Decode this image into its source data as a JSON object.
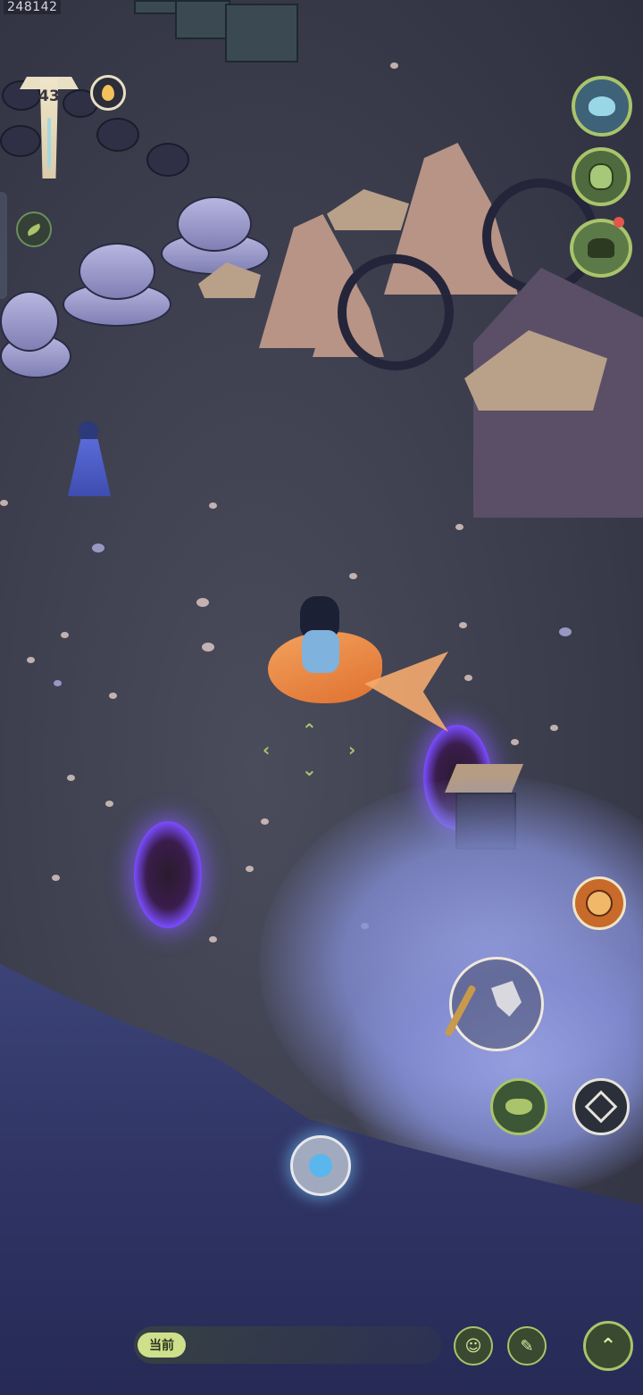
{
  "hud": {
    "player_id": "248142",
    "level": "43",
    "flame_icon": "flame-icon",
    "side_buttons": [
      "leaf-icon"
    ]
  },
  "right_buttons": [
    {
      "name": "wave-button",
      "icon": "wave-icon"
    },
    {
      "name": "jar-button",
      "icon": "jar-icon"
    },
    {
      "name": "monster-button",
      "icon": "monster-icon",
      "notification": true
    }
  ],
  "action_buttons": {
    "face": "face-icon",
    "primary": "axe-icon",
    "cloud": "cloud-icon",
    "diamond": "diamond-icon",
    "orb": "water-orb-icon"
  },
  "chat": {
    "channel_label": "当前",
    "emoji_icon": "☺",
    "brush_icon": "✎",
    "up_icon": "⌃"
  },
  "colors": {
    "accent_green": "#a9c46a",
    "portal_purple": "#7a4cff",
    "notification_red": "#e2574c"
  }
}
